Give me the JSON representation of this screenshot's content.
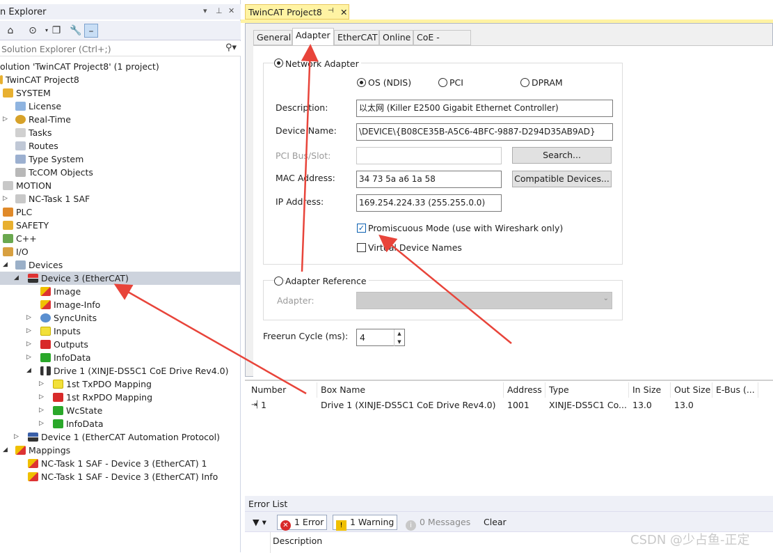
{
  "solution_explorer": {
    "title": "n Explorer",
    "controls": [
      "▾",
      "⊥",
      "✕"
    ],
    "search_placeholder": "Solution Explorer (Ctrl+;)",
    "tree": [
      {
        "label": "olution 'TwinCAT Project8' (1 project)",
        "icon": "solution-icon"
      },
      {
        "label": "TwinCAT Project8",
        "icon": "project-icon"
      },
      {
        "label": "SYSTEM",
        "icon": "system-icon"
      },
      {
        "label": "License",
        "icon": "license-icon"
      },
      {
        "label": "Real-Time",
        "icon": "realtime-icon"
      },
      {
        "label": "Tasks",
        "icon": "tasks-icon"
      },
      {
        "label": "Routes",
        "icon": "routes-icon"
      },
      {
        "label": "Type System",
        "icon": "type-system-icon"
      },
      {
        "label": "TcCOM Objects",
        "icon": "tccom-icon"
      },
      {
        "label": "MOTION",
        "icon": "motion-icon"
      },
      {
        "label": "NC-Task 1 SAF",
        "icon": "nc-task-icon"
      },
      {
        "label": "PLC",
        "icon": "plc-icon"
      },
      {
        "label": "SAFETY",
        "icon": "safety-icon"
      },
      {
        "label": "C++",
        "icon": "cpp-icon"
      },
      {
        "label": "I/O",
        "icon": "io-icon"
      },
      {
        "label": "Devices",
        "icon": "devices-icon"
      },
      {
        "label": "Device 3 (EtherCAT)",
        "icon": "ethercat-device-icon"
      },
      {
        "label": "Image",
        "icon": "image-icon"
      },
      {
        "label": "Image-Info",
        "icon": "image-info-icon"
      },
      {
        "label": "SyncUnits",
        "icon": "syncunits-icon"
      },
      {
        "label": "Inputs",
        "icon": "inputs-icon"
      },
      {
        "label": "Outputs",
        "icon": "outputs-icon"
      },
      {
        "label": "InfoData",
        "icon": "infodata-icon"
      },
      {
        "label": "Drive 1 (XINJE-DS5C1 CoE Drive Rev4.0)",
        "icon": "drive-icon"
      },
      {
        "label": "1st TxPDO Mapping",
        "icon": "txpdo-icon"
      },
      {
        "label": "1st RxPDO Mapping",
        "icon": "rxpdo-icon"
      },
      {
        "label": "WcState",
        "icon": "wcstate-icon"
      },
      {
        "label": "InfoData",
        "icon": "infodata-icon"
      },
      {
        "label": "Device 1 (EtherCAT Automation Protocol)",
        "icon": "eap-device-icon"
      },
      {
        "label": "Mappings",
        "icon": "mappings-icon"
      },
      {
        "label": "NC-Task 1 SAF - Device 3 (EtherCAT) 1",
        "icon": "mapping-icon"
      },
      {
        "label": "NC-Task 1 SAF - Device 3 (EtherCAT) Info",
        "icon": "mapping-icon"
      }
    ]
  },
  "document": {
    "tab_title": "TwinCAT Project8",
    "tab_pin": "⊣",
    "tab_close": "✕",
    "tabs": [
      "General",
      "Adapter",
      "EtherCAT",
      "Online",
      "CoE - Online"
    ],
    "active_tab": "Adapter"
  },
  "adapter": {
    "network_adapter_label": "Network Adapter",
    "os_ndis": "OS (NDIS)",
    "pci": "PCI",
    "dpram": "DPRAM",
    "description_label": "Description:",
    "description_value": "以太网 (Killer E2500 Gigabit Ethernet Controller)",
    "device_name_label": "Device Name:",
    "device_name_value": "\\DEVICE\\{B08CE35B-A5C6-4BFC-9887-D294D35AB9AD}",
    "pci_bus_label": "PCI Bus/Slot:",
    "pci_bus_value": "",
    "search_button": "Search...",
    "mac_label": "MAC Address:",
    "mac_value": "34 73 5a a6 1a 58",
    "compatible_button": "Compatible Devices...",
    "ip_label": "IP Address:",
    "ip_value": "169.254.224.33 (255.255.0.0)",
    "promiscuous_label": "Promiscuous Mode (use with Wireshark only)",
    "virtual_label": "Virtual Device Names",
    "adapter_reference_label": "Adapter Reference",
    "adapter_label": "Adapter:",
    "freerun_label": "Freerun Cycle (ms):",
    "freerun_value": "4"
  },
  "box_list": {
    "columns": [
      "Number",
      "Box Name",
      "Address",
      "Type",
      "In Size",
      "Out Size",
      "E-Bus (..."
    ],
    "rows": [
      [
        "1",
        "Drive 1 (XINJE-DS5C1 CoE Drive Rev4.0)",
        "1001",
        "XINJE-DS5C1 Co...",
        "13.0",
        "13.0",
        ""
      ]
    ]
  },
  "error_list": {
    "title": "Error List",
    "errors": "1 Error",
    "warnings": "1 Warning",
    "messages": "0 Messages",
    "clear": "Clear",
    "description_header": "Description"
  },
  "watermark": "CSDN @少占鱼-正定",
  "colors": {
    "arrow": "#e8443a",
    "tab_yellow": "#fff3a3",
    "selection": "#cdd3dd"
  }
}
